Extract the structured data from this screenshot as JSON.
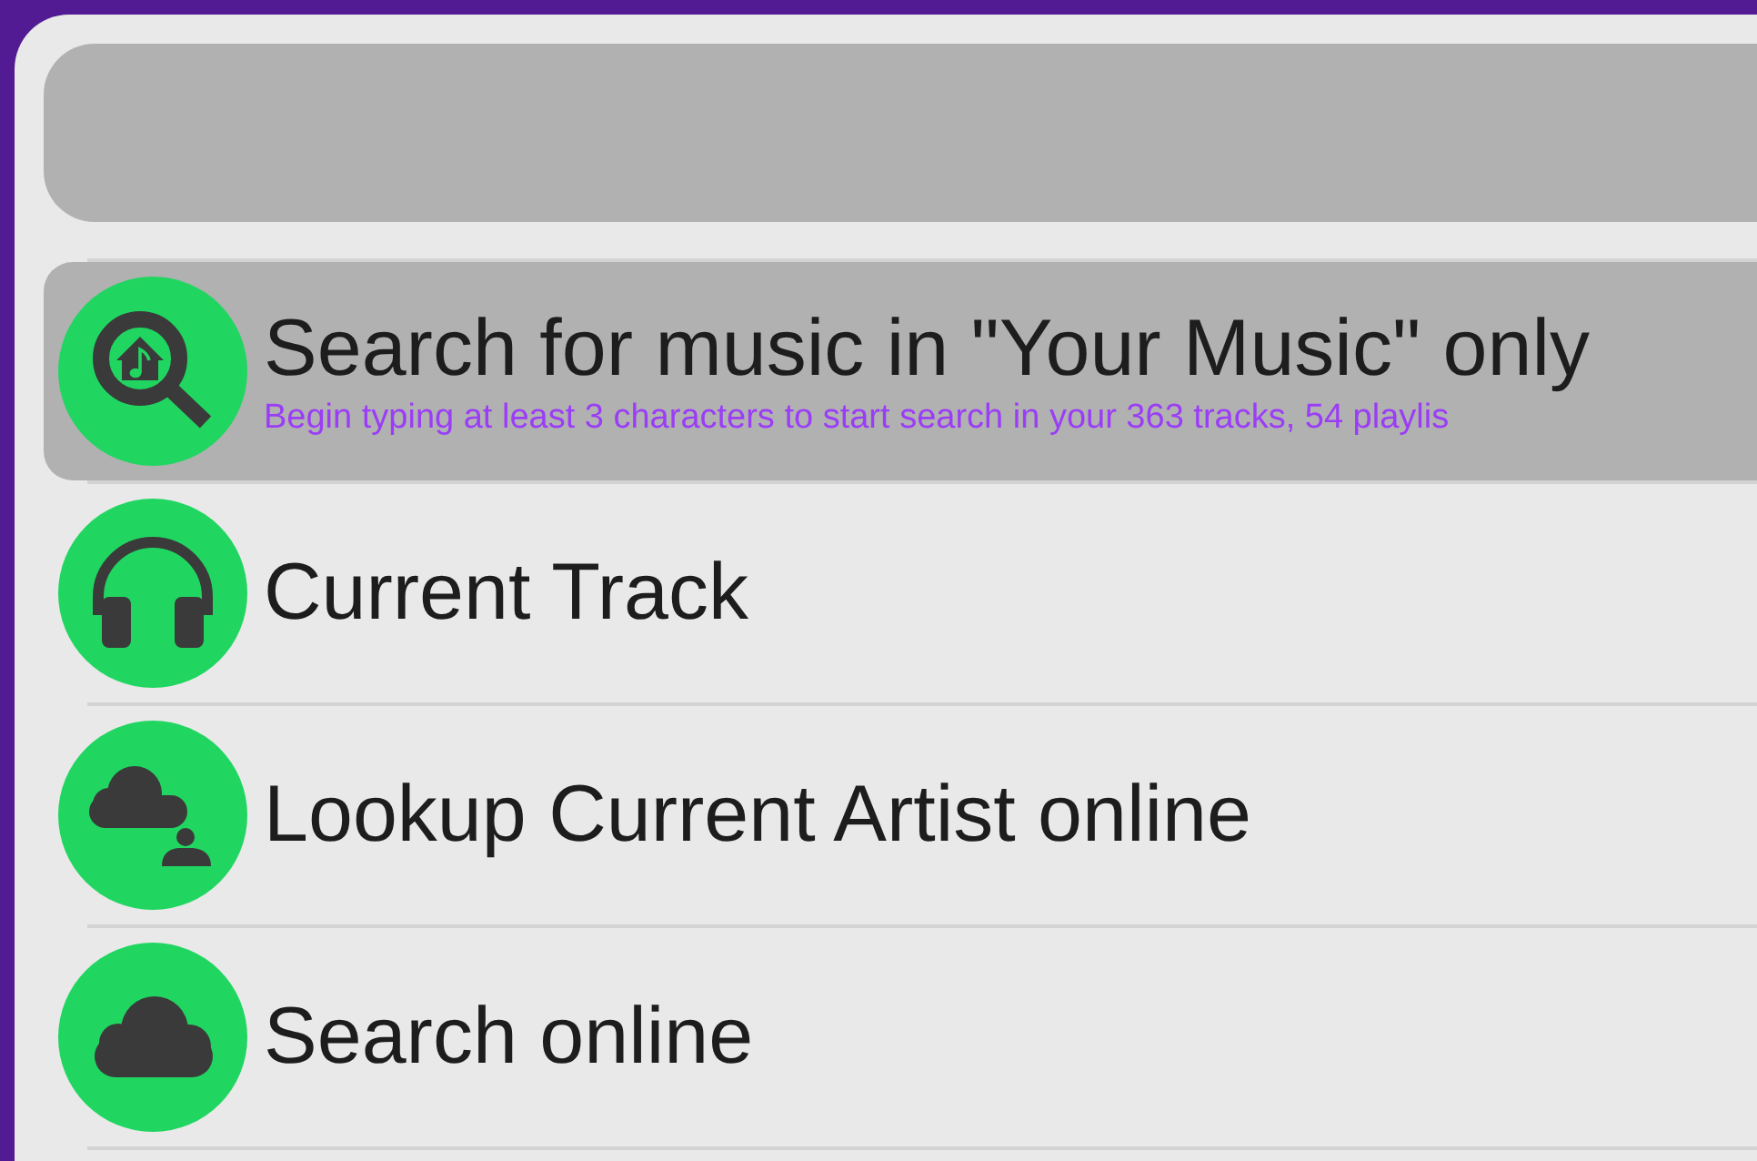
{
  "items": [
    {
      "kind": "library",
      "title": "Search for music in \"Your Music\" only",
      "subtitle": "Begin typing at least 3 characters to start search in your 363 tracks, 54 playlis",
      "selected": true
    },
    {
      "kind": "track",
      "title": "Current Track",
      "selected": false
    },
    {
      "kind": "artist",
      "title": "Lookup Current Artist online",
      "selected": false
    },
    {
      "kind": "web",
      "title": "Search online",
      "selected": false
    }
  ]
}
